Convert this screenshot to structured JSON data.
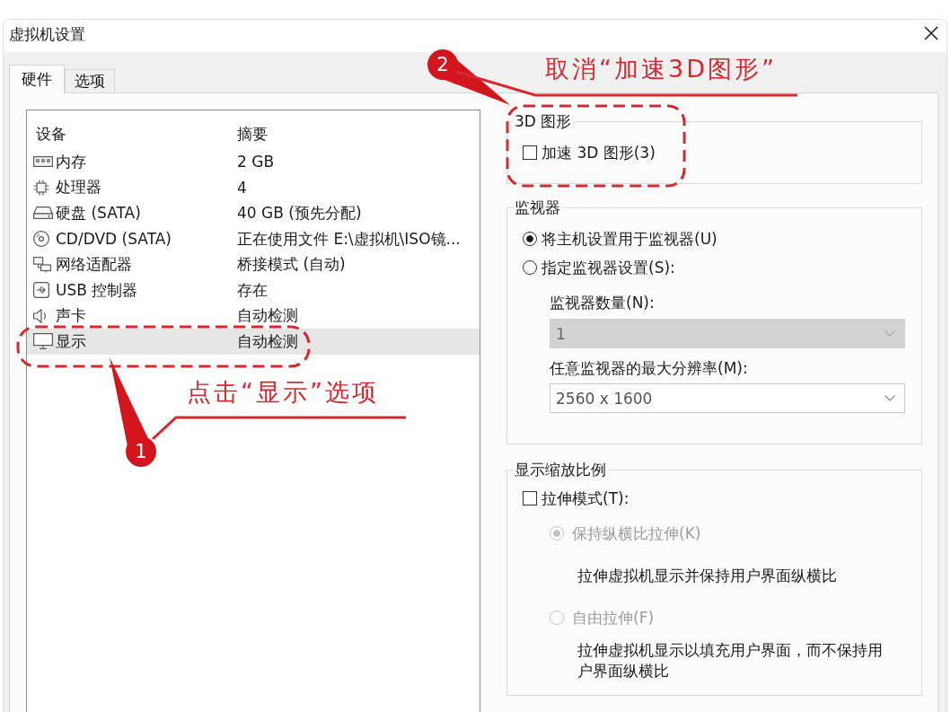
{
  "window": {
    "title": "虚拟机设置"
  },
  "tabs": [
    {
      "label": "硬件",
      "selected": true
    },
    {
      "label": "选项",
      "selected": false
    }
  ],
  "device_list": {
    "columns": [
      "设备",
      "摘要"
    ],
    "rows": [
      {
        "kind": "memory",
        "device": "内存",
        "summary": "2 GB",
        "selected": false
      },
      {
        "kind": "processor",
        "device": "处理器",
        "summary": "4",
        "selected": false
      },
      {
        "kind": "disk",
        "device": "硬盘 (SATA)",
        "summary": "40 GB (预先分配)",
        "selected": false
      },
      {
        "kind": "cd",
        "device": "CD/DVD (SATA)",
        "summary": "正在使用文件 E:\\虚拟机\\ISO镜...",
        "selected": false
      },
      {
        "kind": "network",
        "device": "网络适配器",
        "summary": "桥接模式 (自动)",
        "selected": false
      },
      {
        "kind": "usb",
        "device": "USB 控制器",
        "summary": "存在",
        "selected": false
      },
      {
        "kind": "sound",
        "device": "声卡",
        "summary": "自动检测",
        "selected": false
      },
      {
        "kind": "display",
        "device": "显示",
        "summary": "自动检测",
        "selected": true
      }
    ]
  },
  "graphics_3d": {
    "title": "3D 图形",
    "accelerate": {
      "label": "加速 3D 图形(3)",
      "checked": false
    }
  },
  "monitors": {
    "title": "监视器",
    "options": [
      {
        "label": "将主机设置用于监视器(U)",
        "selected": true
      },
      {
        "label": "指定监视器设置(S):",
        "selected": false
      }
    ],
    "fields": [
      {
        "label": "监视器数量(N):",
        "value": "1",
        "disabled": true
      },
      {
        "label": "任意监视器的最大分辨率(M):",
        "value": "2560 x 1600",
        "disabled": false
      }
    ]
  },
  "display_scaling": {
    "title": "显示缩放比例",
    "stretch": {
      "label": "拉伸模式(T):",
      "checked": false
    },
    "options": [
      {
        "label": "保持纵横比拉伸(K)",
        "selected": true,
        "disabled": true,
        "description": "拉伸虚拟机显示并保持用户界面纵横比"
      },
      {
        "label": "自由拉伸(F)",
        "selected": false,
        "disabled": true,
        "description": "拉伸虚拟机显示以填充用户界面，而不保持用户界面纵横比"
      }
    ]
  },
  "annotations": [
    {
      "number": "1",
      "text": "点击“显示”选项"
    },
    {
      "number": "2",
      "text": "取消“加速3D图形”"
    }
  ]
}
